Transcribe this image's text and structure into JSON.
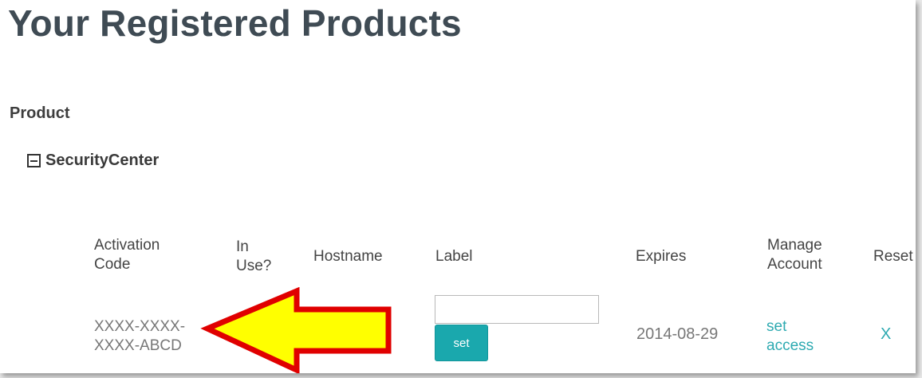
{
  "page": {
    "title": "Your Registered Products"
  },
  "product_heading": "Product",
  "product_group": {
    "name": "SecurityCenter",
    "expanded": true,
    "toggle_icon": "collapse-minus-icon"
  },
  "table": {
    "headers": {
      "activation_code": [
        "Activation",
        "Code"
      ],
      "in_use": [
        "In",
        "Use?"
      ],
      "hostname": "Hostname",
      "label": "Label",
      "expires": "Expires",
      "manage_account": [
        "Manage",
        "Account"
      ],
      "reset": "Reset"
    },
    "rows": [
      {
        "activation_code": [
          "XXXX-XXXX-",
          "XXXX-ABCD"
        ],
        "in_use": "",
        "hostname": "",
        "label_value": "",
        "set_button": "set",
        "expires": "2014-08-29",
        "manage_account_link": [
          "set",
          "access"
        ],
        "reset_link": "X"
      }
    ]
  },
  "annotation": {
    "icon": "left-arrow-callout-icon",
    "fill": "#ffff00",
    "stroke": "#e00000"
  },
  "colors": {
    "accent": "#1aa8ad",
    "link": "#2eaab1",
    "title": "#3f4b54"
  }
}
